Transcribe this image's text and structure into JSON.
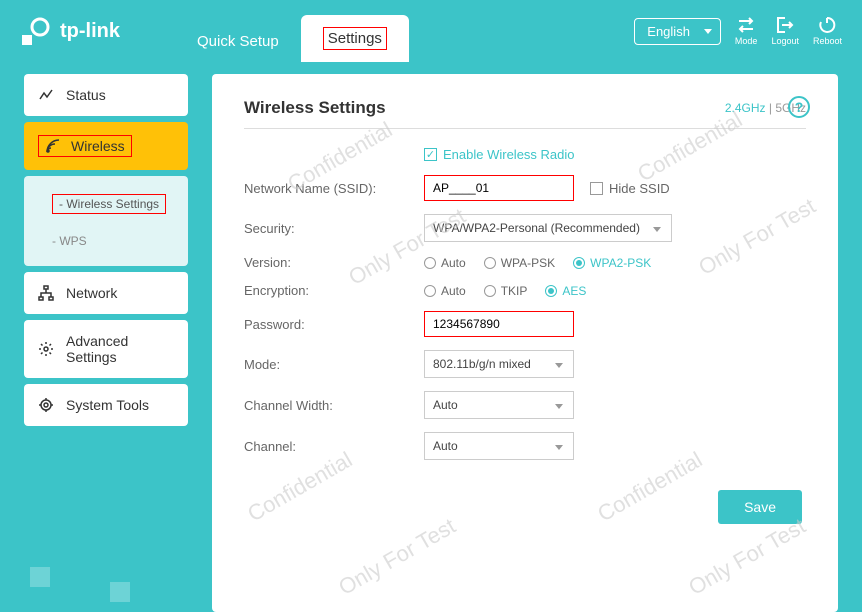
{
  "brand": "tp-link",
  "header": {
    "tabs": {
      "quick_setup": "Quick Setup",
      "settings": "Settings"
    },
    "language": "English",
    "icons": {
      "mode": "Mode",
      "logout": "Logout",
      "reboot": "Reboot"
    }
  },
  "sidebar": {
    "status": "Status",
    "wireless": "Wireless",
    "wireless_sub": {
      "settings": "Wireless Settings",
      "wps": "WPS"
    },
    "network": "Network",
    "advanced": "Advanced Settings",
    "system_tools": "System Tools"
  },
  "page": {
    "title": "Wireless Settings",
    "band24": "2.4GHz",
    "band5": "5GHz",
    "band_sep": " | "
  },
  "form": {
    "enable_label": "Enable Wireless Radio",
    "ssid_label": "Network Name (SSID):",
    "ssid_value": "AP____01",
    "hide_ssid": "Hide SSID",
    "security_label": "Security:",
    "security_value": "WPA/WPA2-Personal (Recommended)",
    "version_label": "Version:",
    "version_options": {
      "auto": "Auto",
      "wpa_psk": "WPA-PSK",
      "wpa2_psk": "WPA2-PSK"
    },
    "encryption_label": "Encryption:",
    "encryption_options": {
      "auto": "Auto",
      "tkip": "TKIP",
      "aes": "AES"
    },
    "password_label": "Password:",
    "password_value": "1234567890",
    "mode_label": "Mode:",
    "mode_value": "802.11b/g/n mixed",
    "channel_width_label": "Channel Width:",
    "channel_width_value": "Auto",
    "channel_label": "Channel:",
    "channel_value": "Auto",
    "save": "Save"
  },
  "watermarks": {
    "conf": "Confidential",
    "test": "Only For Test"
  }
}
